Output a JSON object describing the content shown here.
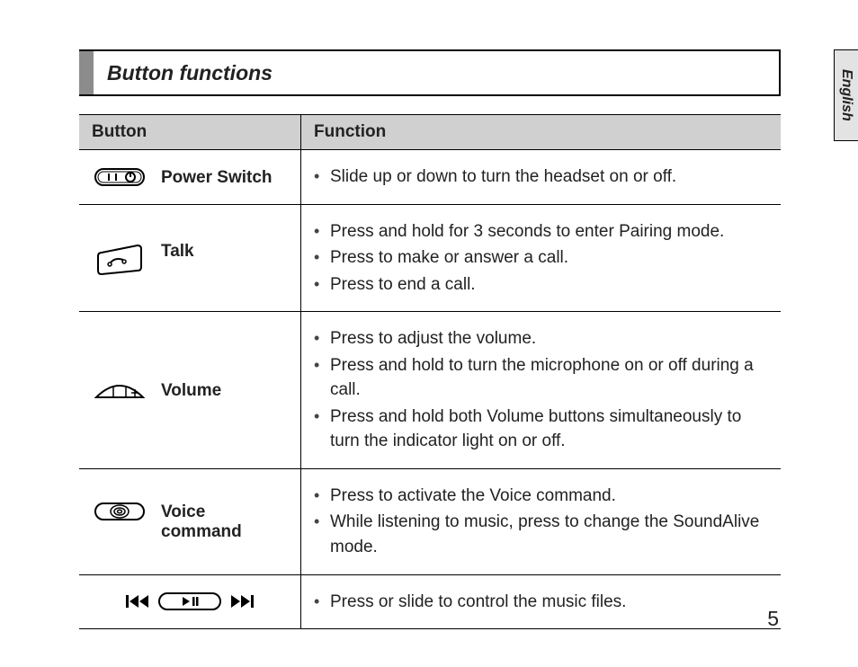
{
  "language_tab": "English",
  "section_title": "Button functions",
  "table": {
    "headers": {
      "c1": "Button",
      "c2": "Function"
    },
    "rows": [
      {
        "name": "Power Switch",
        "functions": [
          "Slide up or down to turn the headset on or off."
        ]
      },
      {
        "name": "Talk",
        "functions": [
          "Press and hold for 3 seconds to enter Pairing mode.",
          "Press to make or answer a call.",
          "Press to end a call."
        ]
      },
      {
        "name": "Volume",
        "functions": [
          "Press to adjust the volume.",
          "Press and hold to turn the microphone on or off during a call.",
          "Press and hold both Volume buttons simultaneously to turn the indicator light on or off."
        ]
      },
      {
        "name": "Voice command",
        "functions": [
          "Press to activate the Voice command.",
          "While listening to music, press to change the SoundAlive mode."
        ]
      },
      {
        "name": "",
        "functions": [
          "Press or slide to control the music files."
        ]
      }
    ]
  },
  "page_number": "5"
}
